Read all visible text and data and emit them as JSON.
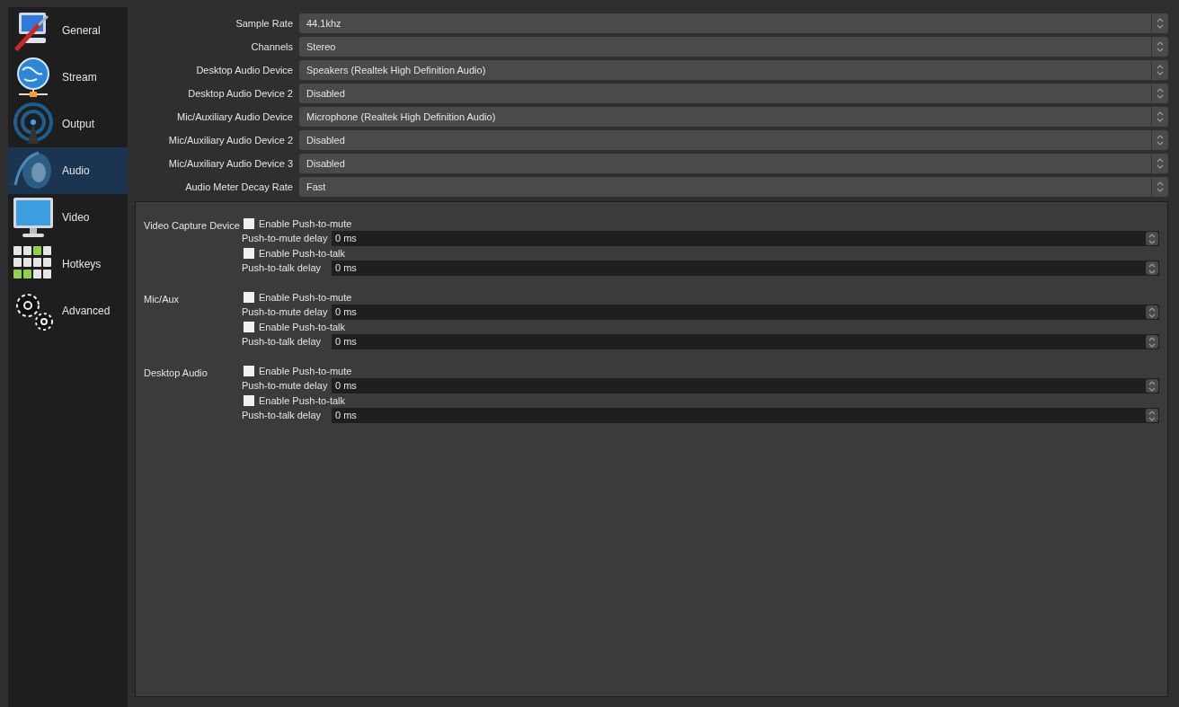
{
  "sidebar": {
    "items": [
      {
        "label": "General",
        "selected": false
      },
      {
        "label": "Stream",
        "selected": false
      },
      {
        "label": "Output",
        "selected": false
      },
      {
        "label": "Audio",
        "selected": true
      },
      {
        "label": "Video",
        "selected": false
      },
      {
        "label": "Hotkeys",
        "selected": false
      },
      {
        "label": "Advanced",
        "selected": false
      }
    ]
  },
  "settings": [
    {
      "label": "Sample Rate",
      "value": "44.1khz"
    },
    {
      "label": "Channels",
      "value": "Stereo"
    },
    {
      "label": "Desktop Audio Device",
      "value": "Speakers (Realtek High Definition Audio)"
    },
    {
      "label": "Desktop Audio Device 2",
      "value": "Disabled"
    },
    {
      "label": "Mic/Auxiliary Audio Device",
      "value": "Microphone (Realtek High Definition Audio)"
    },
    {
      "label": "Mic/Auxiliary Audio Device 2",
      "value": "Disabled"
    },
    {
      "label": "Mic/Auxiliary Audio Device 3",
      "value": "Disabled"
    },
    {
      "label": "Audio Meter Decay Rate",
      "value": "Fast"
    }
  ],
  "hotkey_groups": [
    {
      "source": "Video Capture Device",
      "rows": [
        {
          "kind": "checkbox",
          "label": "Enable Push-to-mute",
          "checked": false
        },
        {
          "kind": "spin",
          "label": "Push-to-mute delay",
          "value": "0 ms"
        },
        {
          "kind": "checkbox",
          "label": "Enable Push-to-talk",
          "checked": false
        },
        {
          "kind": "spin",
          "label": "Push-to-talk delay",
          "value": "0 ms"
        }
      ]
    },
    {
      "source": "Mic/Aux",
      "rows": [
        {
          "kind": "checkbox",
          "label": "Enable Push-to-mute",
          "checked": false
        },
        {
          "kind": "spin",
          "label": "Push-to-mute delay",
          "value": "0 ms"
        },
        {
          "kind": "checkbox",
          "label": "Enable Push-to-talk",
          "checked": false
        },
        {
          "kind": "spin",
          "label": "Push-to-talk delay",
          "value": "0 ms"
        }
      ]
    },
    {
      "source": "Desktop Audio",
      "rows": [
        {
          "kind": "checkbox",
          "label": "Enable Push-to-mute",
          "checked": false
        },
        {
          "kind": "spin",
          "label": "Push-to-mute delay",
          "value": "0 ms"
        },
        {
          "kind": "checkbox",
          "label": "Enable Push-to-talk",
          "checked": false
        },
        {
          "kind": "spin",
          "label": "Push-to-talk delay",
          "value": "0 ms"
        }
      ]
    }
  ]
}
